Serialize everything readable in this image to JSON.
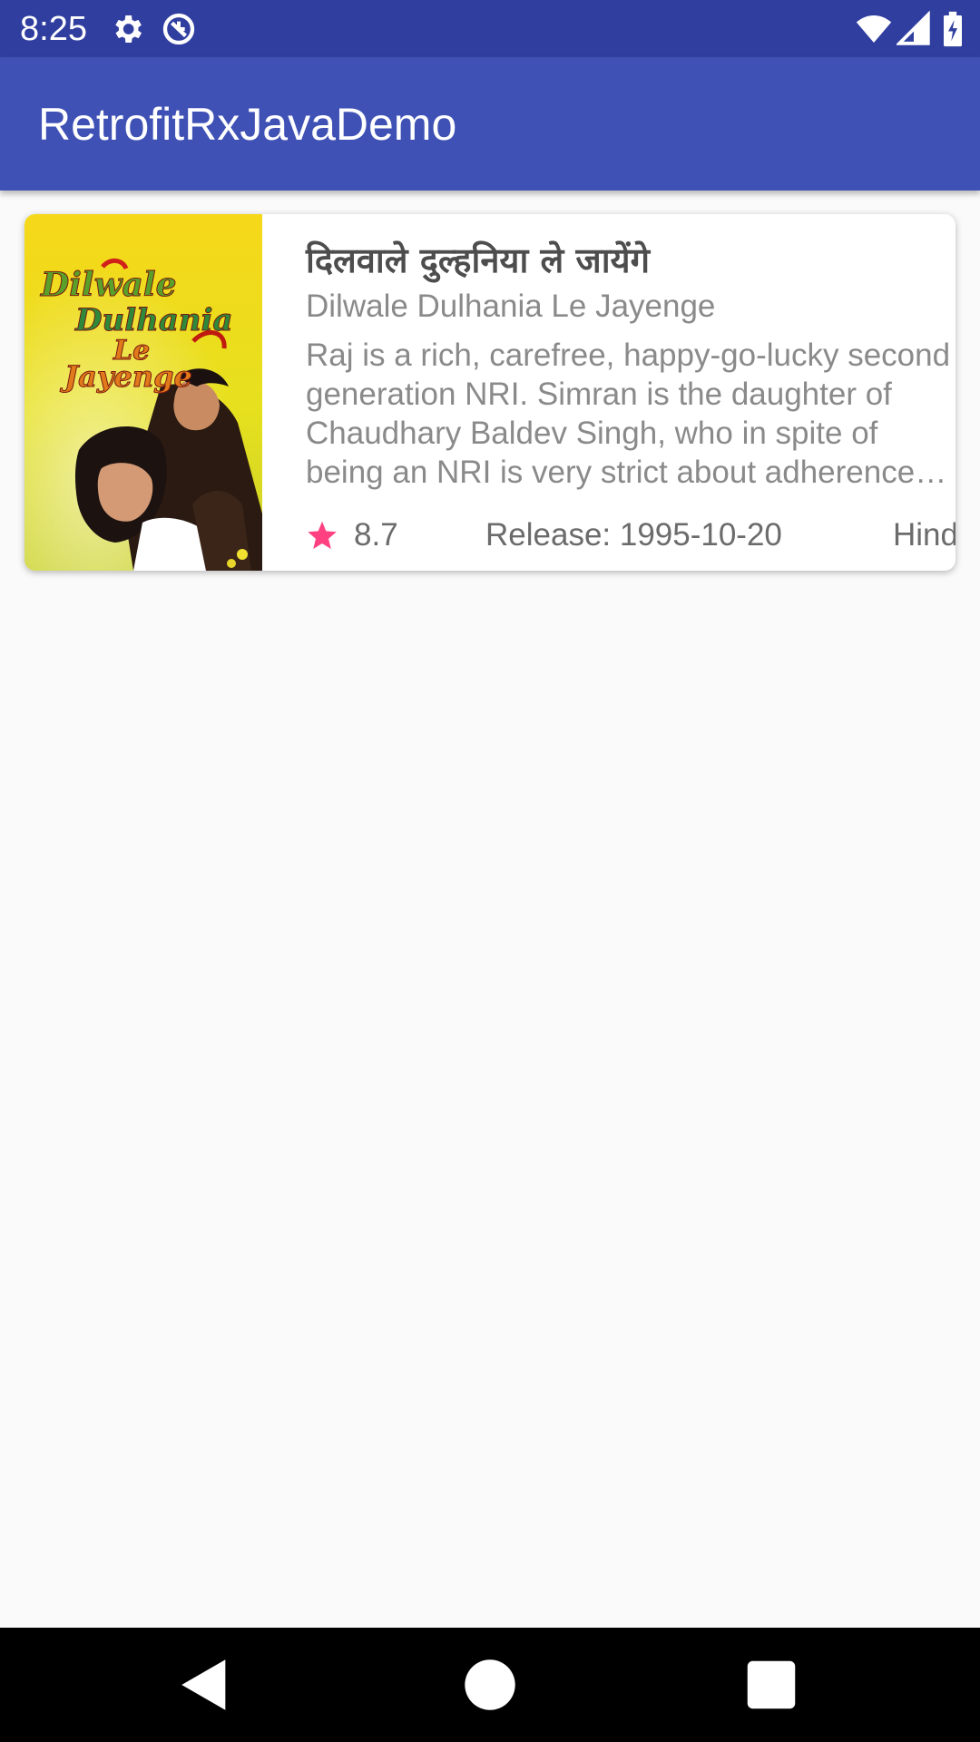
{
  "status_bar": {
    "time": "8:25",
    "icons": [
      "settings-icon",
      "sync-icon",
      "wifi-icon",
      "signal-icon",
      "battery-charging-icon"
    ]
  },
  "app_bar": {
    "title": "RetrofitRxJavaDemo"
  },
  "movies": [
    {
      "title": "दिलवाले दुल्हनिया ले जायेंगे",
      "original_title": "Dilwale Dulhania Le Jayenge",
      "overview": "Raj is a rich, carefree, happy-go-lucky second generation NRI. Simran is the daughter of Chaudhary Baldev Singh, who in spite of being an NRI is very strict about adherence to Indian values.",
      "rating": "8.7",
      "release": "Release: 1995-10-20",
      "language": "Hindi",
      "poster_text": [
        "Dilwale",
        "Dulhania",
        "Le",
        "Jayenge"
      ]
    }
  ],
  "colors": {
    "status_bar": "#303f9f",
    "app_bar": "#3f51b5",
    "accent_star": "#ff4081",
    "background": "#fafafa"
  },
  "nav_bar": {
    "icons": [
      "back-icon",
      "home-icon",
      "recents-icon"
    ]
  }
}
